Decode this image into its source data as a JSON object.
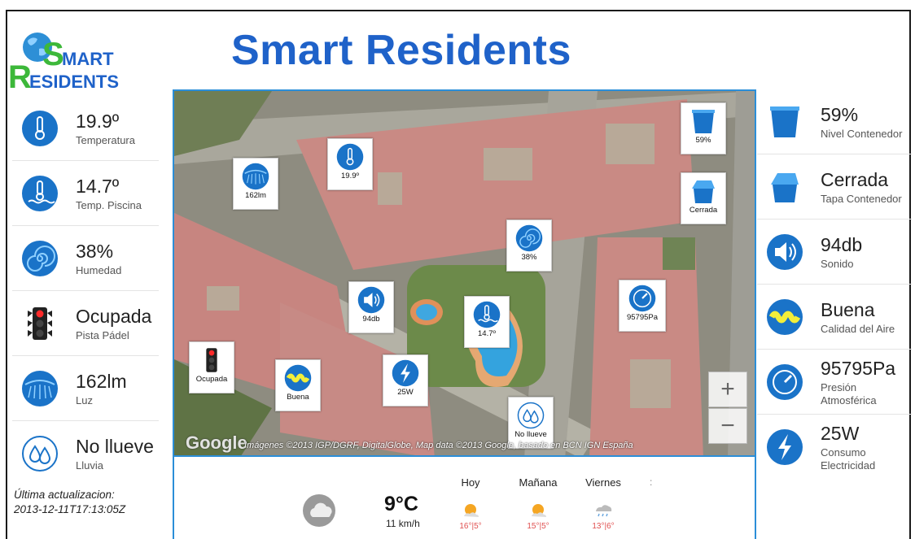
{
  "header": {
    "title": "Smart Residents",
    "logo_text_top": "MART",
    "logo_text_bottom": "ESIDENTS",
    "logo_letter_s": "S",
    "logo_letter_r": "R"
  },
  "left_sensors": [
    {
      "value": "19.9º",
      "label": "Temperatura",
      "icon": "thermometer-icon"
    },
    {
      "value": "14.7º",
      "label": "Temp. Piscina",
      "icon": "pool-thermometer-icon"
    },
    {
      "value": "38%",
      "label": "Humedad",
      "icon": "humidity-spiral-icon"
    },
    {
      "value": "Ocupada",
      "label": "Pista Pádel",
      "icon": "traffic-light-icon"
    },
    {
      "value": "162lm",
      "label": "Luz",
      "icon": "light-icon"
    },
    {
      "value": "No llueve",
      "label": "Lluvia",
      "icon": "rain-drops-icon"
    }
  ],
  "right_sensors": [
    {
      "value": "59%",
      "label": "Nivel Contenedor",
      "icon": "bin-icon"
    },
    {
      "value": "Cerrada",
      "label": "Tapa Contenedor",
      "icon": "bin-lid-icon"
    },
    {
      "value": "94db",
      "label": "Sonido",
      "icon": "speaker-icon"
    },
    {
      "value": "Buena",
      "label": "Calidad del Aire",
      "icon": "air-quality-icon"
    },
    {
      "value": "95795Pa",
      "label": "Presión Atmosférica",
      "icon": "gauge-icon"
    },
    {
      "value": "25W",
      "label": "Consumo Electricidad",
      "icon": "lightning-icon"
    }
  ],
  "update": {
    "label": "Última actualizacion:",
    "timestamp": "2013-12-11T17:13:05Z"
  },
  "map": {
    "markers": {
      "bin_level": "59%",
      "lid": "Cerrada",
      "temperature": "19.9º",
      "light": "162lm",
      "humidity": "38%",
      "sound": "94db",
      "pool_temp": "14.7º",
      "pressure": "95795Pa",
      "padel": "Ocupada",
      "air": "Buena",
      "power": "25W",
      "rain": "No llueve"
    },
    "zoom_in": "+",
    "zoom_out": "−",
    "google_logo": "Google",
    "attribution": "Imágenes ©2013 IGP/DGRF, DigitalGlobe, Map data ©2013 Google, basado en BCN IGN España"
  },
  "weather": {
    "current_temp": "9°C",
    "wind": "11 km/h",
    "days": [
      {
        "name": "Hoy",
        "range": "16°|5°"
      },
      {
        "name": "Mañana",
        "range": "15°|5°"
      },
      {
        "name": "Viernes",
        "range": "13°|6°"
      }
    ],
    "more": ":"
  },
  "colors": {
    "brand_blue": "#1f62c9",
    "icon_blue": "#1a73c8",
    "map_border": "#2b8ed8",
    "logo_green": "#3db83a"
  }
}
